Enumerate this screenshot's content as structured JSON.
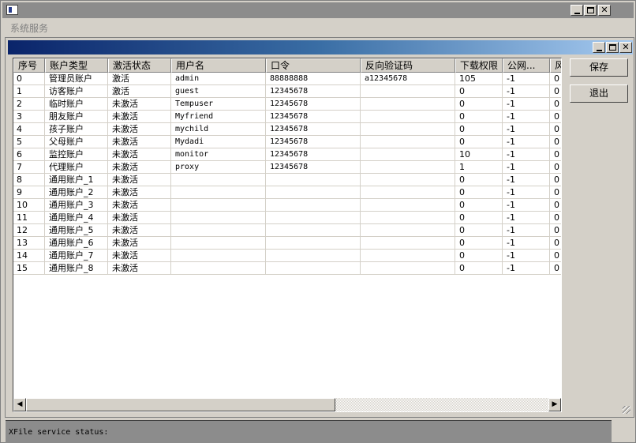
{
  "menu": {
    "items": [
      "系统服务"
    ]
  },
  "grid": {
    "columns": [
      "序号",
      "账户类型",
      "激活状态",
      "用户名",
      "口令",
      "反向验证码",
      "下载权限",
      "公网...",
      "风"
    ],
    "rows": [
      [
        "0",
        "管理员账户",
        "激活",
        "admin",
        "88888888",
        "a12345678",
        "105",
        "-1",
        "0"
      ],
      [
        "1",
        "访客账户",
        "激活",
        "guest",
        "12345678",
        "",
        "0",
        "-1",
        "0"
      ],
      [
        "2",
        "临时账户",
        "未激活",
        "Tempuser",
        "12345678",
        "",
        "0",
        "-1",
        "0"
      ],
      [
        "3",
        "朋友账户",
        "未激活",
        "Myfriend",
        "12345678",
        "",
        "0",
        "-1",
        "0"
      ],
      [
        "4",
        "孩子账户",
        "未激活",
        "mychild",
        "12345678",
        "",
        "0",
        "-1",
        "0"
      ],
      [
        "5",
        "父母账户",
        "未激活",
        "Mydadi",
        "12345678",
        "",
        "0",
        "-1",
        "0"
      ],
      [
        "6",
        "监控账户",
        "未激活",
        "monitor",
        "12345678",
        "",
        "10",
        "-1",
        "0"
      ],
      [
        "7",
        "代理账户",
        "未激活",
        "proxy",
        "12345678",
        "",
        "1",
        "-1",
        "0"
      ],
      [
        "8",
        "通用账户_1",
        "未激活",
        "",
        "",
        "",
        "0",
        "-1",
        "0"
      ],
      [
        "9",
        "通用账户_2",
        "未激活",
        "",
        "",
        "",
        "0",
        "-1",
        "0"
      ],
      [
        "10",
        "通用账户_3",
        "未激活",
        "",
        "",
        "",
        "0",
        "-1",
        "0"
      ],
      [
        "11",
        "通用账户_4",
        "未激活",
        "",
        "",
        "",
        "0",
        "-1",
        "0"
      ],
      [
        "12",
        "通用账户_5",
        "未激活",
        "",
        "",
        "",
        "0",
        "-1",
        "0"
      ],
      [
        "13",
        "通用账户_6",
        "未激活",
        "",
        "",
        "",
        "0",
        "-1",
        "0"
      ],
      [
        "14",
        "通用账户_7",
        "未激活",
        "",
        "",
        "",
        "0",
        "-1",
        "0"
      ],
      [
        "15",
        "通用账户_8",
        "未激活",
        "",
        "",
        "",
        "0",
        "-1",
        "0"
      ]
    ]
  },
  "buttons": {
    "save": "保存",
    "exit": "退出"
  },
  "status": {
    "text": "XFile service status:"
  },
  "colors": {
    "inner_title_start": "#0a246a",
    "inner_title_end": "#a6caf0",
    "face": "#d4d0c8"
  },
  "icons": [
    "app-icon",
    "minimize-icon",
    "maximize-icon",
    "close-icon",
    "scroll-left-icon",
    "scroll-right-icon",
    "resize-grip-icon"
  ]
}
